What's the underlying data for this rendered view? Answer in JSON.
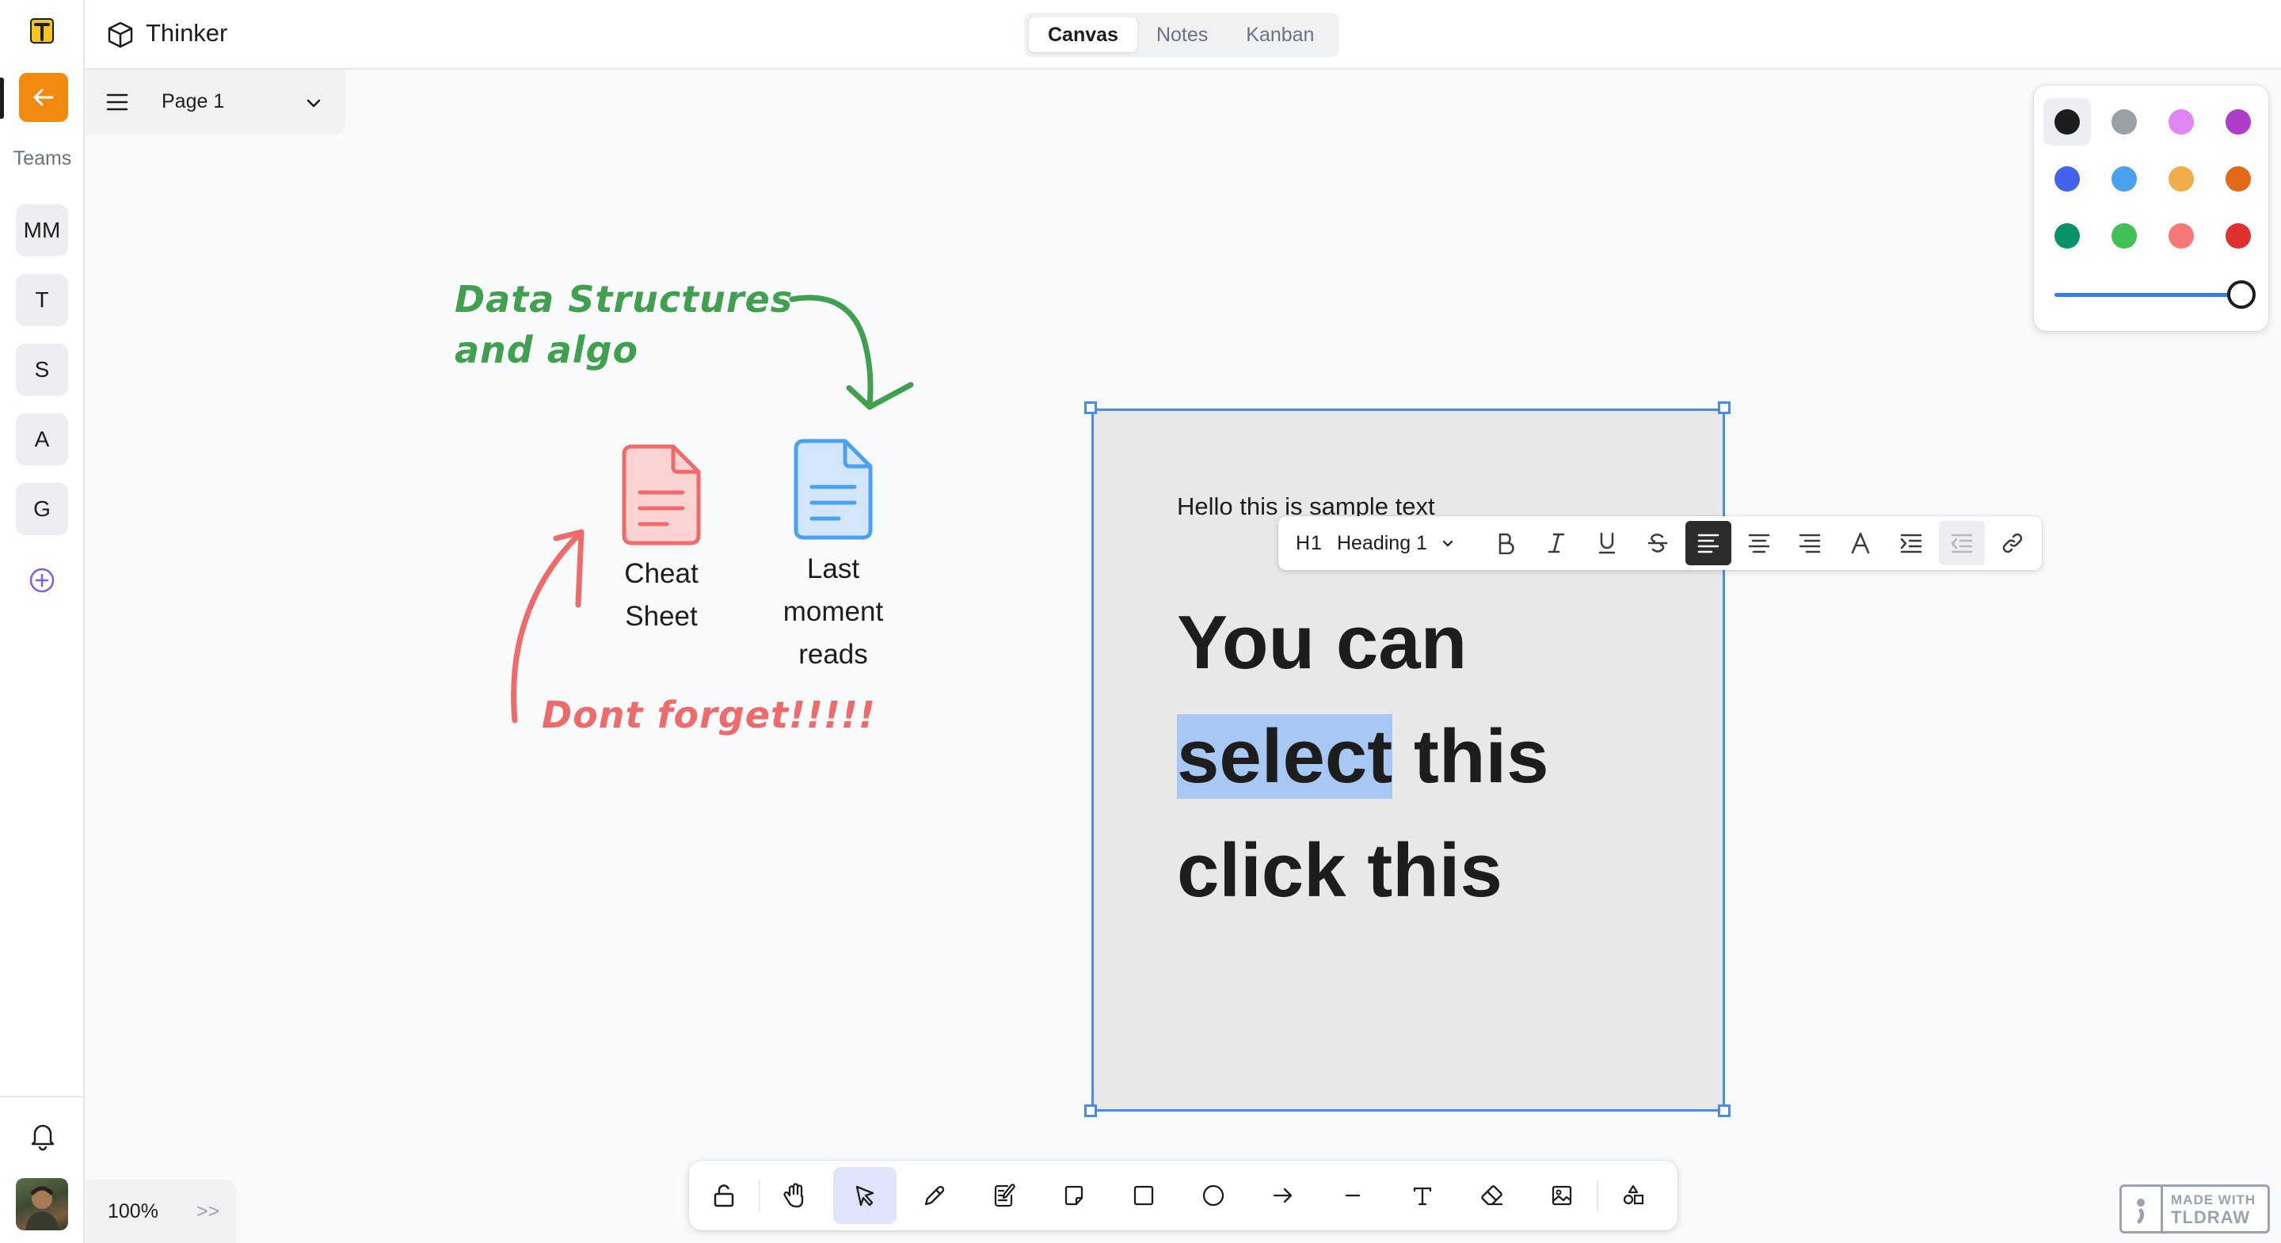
{
  "app": {
    "title": "Thinker"
  },
  "sidebar": {
    "teams_label": "Teams",
    "teams": [
      {
        "label": "MM"
      },
      {
        "label": "T"
      },
      {
        "label": "S"
      },
      {
        "label": "A"
      },
      {
        "label": "G"
      }
    ]
  },
  "view_tabs": [
    {
      "label": "Canvas",
      "active": true
    },
    {
      "label": "Notes",
      "active": false
    },
    {
      "label": "Kanban",
      "active": false
    }
  ],
  "page_menu": {
    "label": "Page 1"
  },
  "palette": {
    "colors": [
      "#1d1d1d",
      "#9aa0a8",
      "#e085f4",
      "#ae3ec9",
      "#4263eb",
      "#4ba1f1",
      "#f1ac4b",
      "#e16919",
      "#099268",
      "#40c057",
      "#f87777",
      "#e03131"
    ],
    "selected": "#1d1d1d",
    "size_level": 1.0
  },
  "canvas": {
    "annotation_green": "Data Structures and algo",
    "annotation_green_line1": "Data Structures",
    "annotation_green_line2": "and algo",
    "annotation_red": "Dont forget!!!!!",
    "file_cheat_line1": "Cheat",
    "file_cheat_line2": "Sheet",
    "file_last_line1": "Last",
    "file_last_line2": "moment",
    "file_last_line3": "reads",
    "sample_text": "Hello this is sample text",
    "heading_line1": "You can",
    "heading_selected": "select",
    "heading_line2_rest": " this",
    "heading_line3": "click this"
  },
  "format_toolbar": {
    "heading_icon": "H1",
    "heading_select": "Heading 1",
    "buttons": [
      "bold",
      "italic",
      "underline",
      "strikethrough",
      "align-left",
      "align-center",
      "align-right",
      "text-color",
      "indent",
      "outdent",
      "link"
    ]
  },
  "zoom": {
    "value": "100%",
    "expand": ">>"
  },
  "tools": [
    "lock",
    "hand",
    "select",
    "draw",
    "note-edit",
    "note",
    "rectangle",
    "ellipse",
    "arrow",
    "line",
    "text",
    "eraser",
    "image",
    "shapes"
  ],
  "active_tool": "select",
  "watermark": {
    "line1": "MADE WITH",
    "line2": "TLDRAW"
  },
  "colors": {
    "accent_orange": "#f08a10",
    "selection_blue": "#4a8de8",
    "green_note": "#40a050",
    "red_note": "#ef6b6b",
    "highlight": "#a8c8f4"
  }
}
